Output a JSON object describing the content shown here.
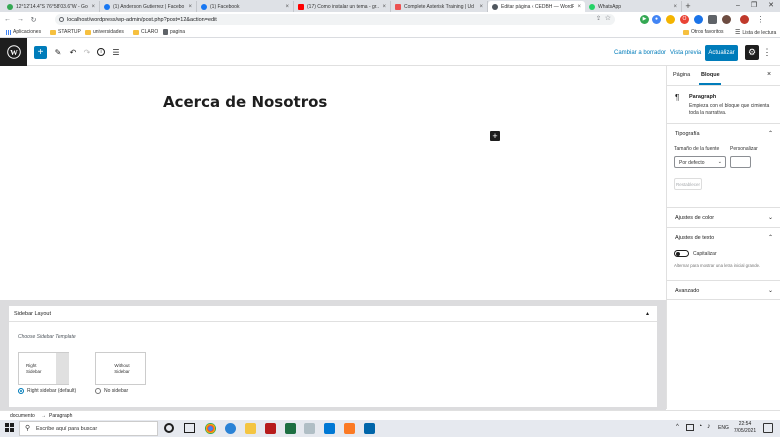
{
  "browser": {
    "tabs": [
      {
        "label": "12°12'14.4\"S 76°58'03.6\"W - Goo",
        "color": "#34a853",
        "active": false
      },
      {
        "label": "(1) Anderson Gutierrez | Facebo",
        "color": "#1877f2",
        "active": false
      },
      {
        "label": "(1) Facebook",
        "color": "#1877f2",
        "active": false
      },
      {
        "label": "(17) Como instalar un tema - gr...",
        "color": "#ff0000",
        "active": false
      },
      {
        "label": "Complete Asterisk Training | Ud",
        "color": "#ec5252",
        "active": false
      },
      {
        "label": "Editar página ‹ CEDBH — WordP",
        "color": "#50575e",
        "active": true
      },
      {
        "label": "WhatsApp",
        "color": "#25d366",
        "active": false
      }
    ],
    "new_tab": "+",
    "address": "localhost/wordpress/wp-admin/post.php?post=12&action=edit",
    "bookmarks": [
      {
        "label": "Aplicaciones",
        "type": "apps"
      },
      {
        "label": "STARTUP",
        "type": "folder"
      },
      {
        "label": "universidades",
        "type": "folder"
      },
      {
        "label": "CLARO",
        "type": "folder"
      },
      {
        "label": "pagina",
        "type": "page"
      }
    ],
    "other_bookmarks": "Otros favoritos",
    "reading_list": "Lista de lectura"
  },
  "wp_toolbar": {
    "add_block": "+",
    "switch_to_draft": "Cambiar a borrador",
    "preview": "Vista previa",
    "update": "Actualizar"
  },
  "editor": {
    "title": "Acerca de Nosotros",
    "inserter": "+"
  },
  "sidebar": {
    "tabs": [
      "Página",
      "Bloque"
    ],
    "active_tab": "Bloque",
    "block_name": "Paragraph",
    "block_description": "Empieza con el bloque que cimienta toda la narrativa.",
    "typography": {
      "title": "Tipografía",
      "font_size_label": "Tamaño de la fuente",
      "custom_label": "Personalizar",
      "font_size_value": "Por defecto",
      "reset": "Restablecer"
    },
    "color_settings": "Ajustes de color",
    "text_settings": {
      "title": "Ajustes de texto",
      "toggle_label": "Capitalizar",
      "help": "Alternar para mostrar una letra inicial grande."
    },
    "advanced": "Avanzado"
  },
  "metabox": {
    "title": "Sidebar Layout",
    "subtitle": "Choose Sidebar Template",
    "options": [
      {
        "label": "Right Sidebar",
        "caption": "Right sidebar (default)",
        "selected": true
      },
      {
        "label": "Without Sidebar",
        "caption": "No sidebar",
        "selected": false
      }
    ]
  },
  "breadcrumb": [
    "documento",
    "→",
    "Paragraph"
  ],
  "taskbar": {
    "search_placeholder": "Escribe aquí para buscar",
    "language": "ENG",
    "time": "22:54",
    "date": "7/05/2021"
  },
  "colors": {
    "wp_blue": "#007cba",
    "wp_dark": "#1e1e1e"
  }
}
